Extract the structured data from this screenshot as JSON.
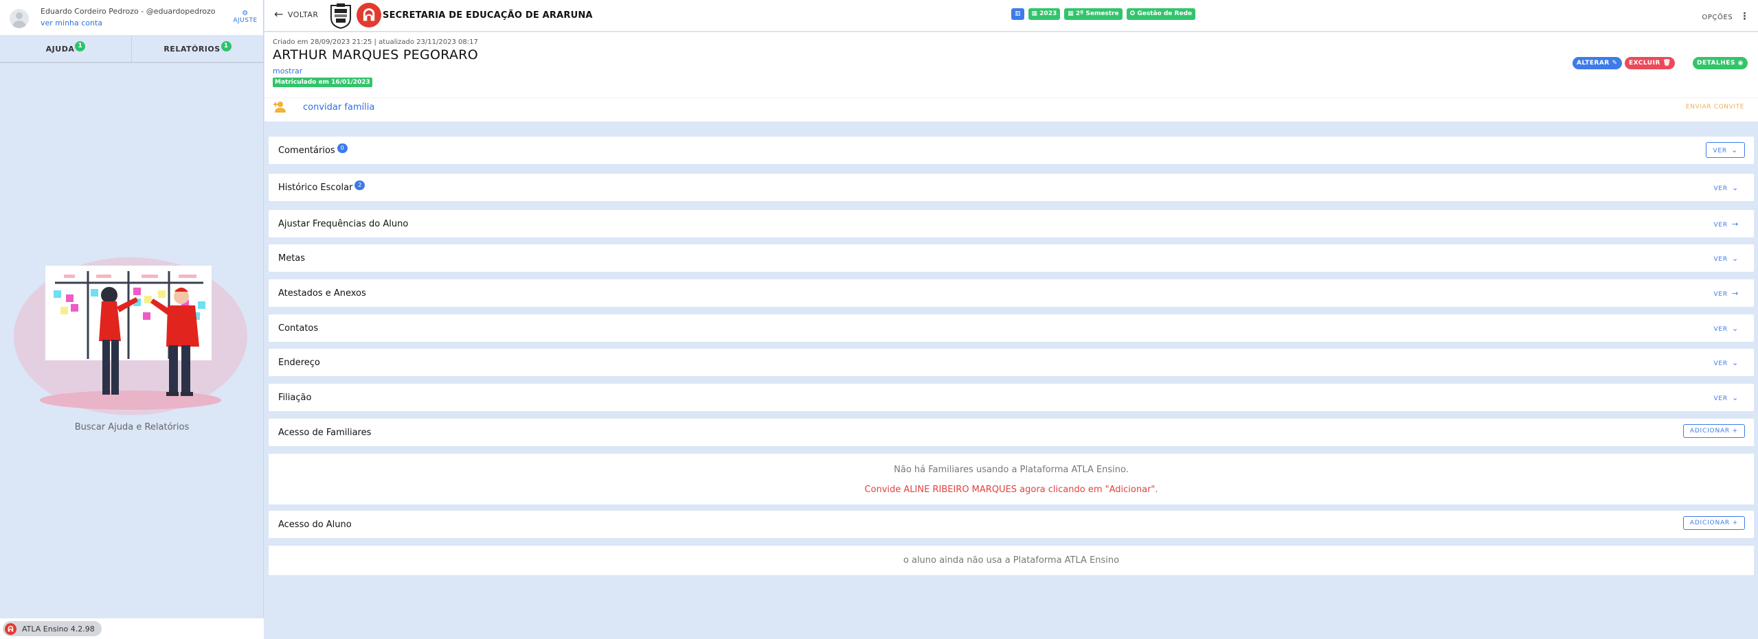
{
  "user": {
    "name": "Eduardo Cordeiro Pedrozo - @eduardopedrozo",
    "account_link": "ver minha conta",
    "adjust_label": "AJUSTE"
  },
  "sidebar": {
    "tabs": [
      {
        "label": "AJUDA",
        "count": "1"
      },
      {
        "label": "RELATÓRIOS",
        "count": "1"
      }
    ],
    "caption": "Buscar Ajuda e Relatórios",
    "version": "ATLA Ensino 4.2.98"
  },
  "topbar": {
    "back_label": "VOLTAR",
    "org_name": "SECRETARIA DE EDUCAÇÃO DE ARARUNA",
    "chips": {
      "year": "2023",
      "semester": "2º Semestre",
      "network": "Gestão de Rede"
    },
    "options_label": "OPÇÕES"
  },
  "student": {
    "meta": "Criado em 28/09/2023 21:25 | atualizado 23/11/2023 08:17",
    "name": "ARTHUR MARQUES PEGORARO",
    "show_link": "mostrar",
    "enrollment_badge": "Matriculado em 16/01/2023",
    "actions": {
      "alter": "ALTERAR",
      "delete": "EXCLUIR",
      "details": "DETALHES"
    },
    "invite_link": "convidar família",
    "invite_send": "ENVIAR CONVITE"
  },
  "sections": [
    {
      "title": "Comentários",
      "badge": "0",
      "action": "VER"
    },
    {
      "title": "Histórico Escolar",
      "badge": "2",
      "action": "VER"
    },
    {
      "title": "Ajustar Frequências do Aluno",
      "action": "VER"
    },
    {
      "title": "Metas",
      "action": "VER"
    },
    {
      "title": "Atestados e Anexos",
      "action": "VER"
    },
    {
      "title": "Contatos",
      "action": "VER"
    },
    {
      "title": "Endereço",
      "action": "VER"
    },
    {
      "title": "Filiação",
      "action": "VER"
    },
    {
      "title": "Acesso de Familiares",
      "action": "ADICIONAR"
    },
    {
      "title": "Acesso do Aluno",
      "action": "ADICIONAR"
    }
  ],
  "family_access": {
    "empty": "Não há Familiares usando a Plataforma ATLA Ensino.",
    "invite": "Convide ALINE RIBEIRO MARQUES agora clicando em \"Adicionar\"."
  },
  "student_access": {
    "empty": "o aluno ainda não usa a Plataforma ATLA Ensino"
  },
  "colors": {
    "primary": "#3d7be8",
    "success": "#33c46b",
    "danger": "#ea4a5a",
    "brand": "#e23a2f",
    "background": "#dbe6f7"
  },
  "icons": {
    "back": "arrow-left-icon",
    "options": "kebab-menu-icon",
    "expand": "chevron-down-icon",
    "navigate": "arrow-right-icon",
    "add": "plus-icon"
  }
}
